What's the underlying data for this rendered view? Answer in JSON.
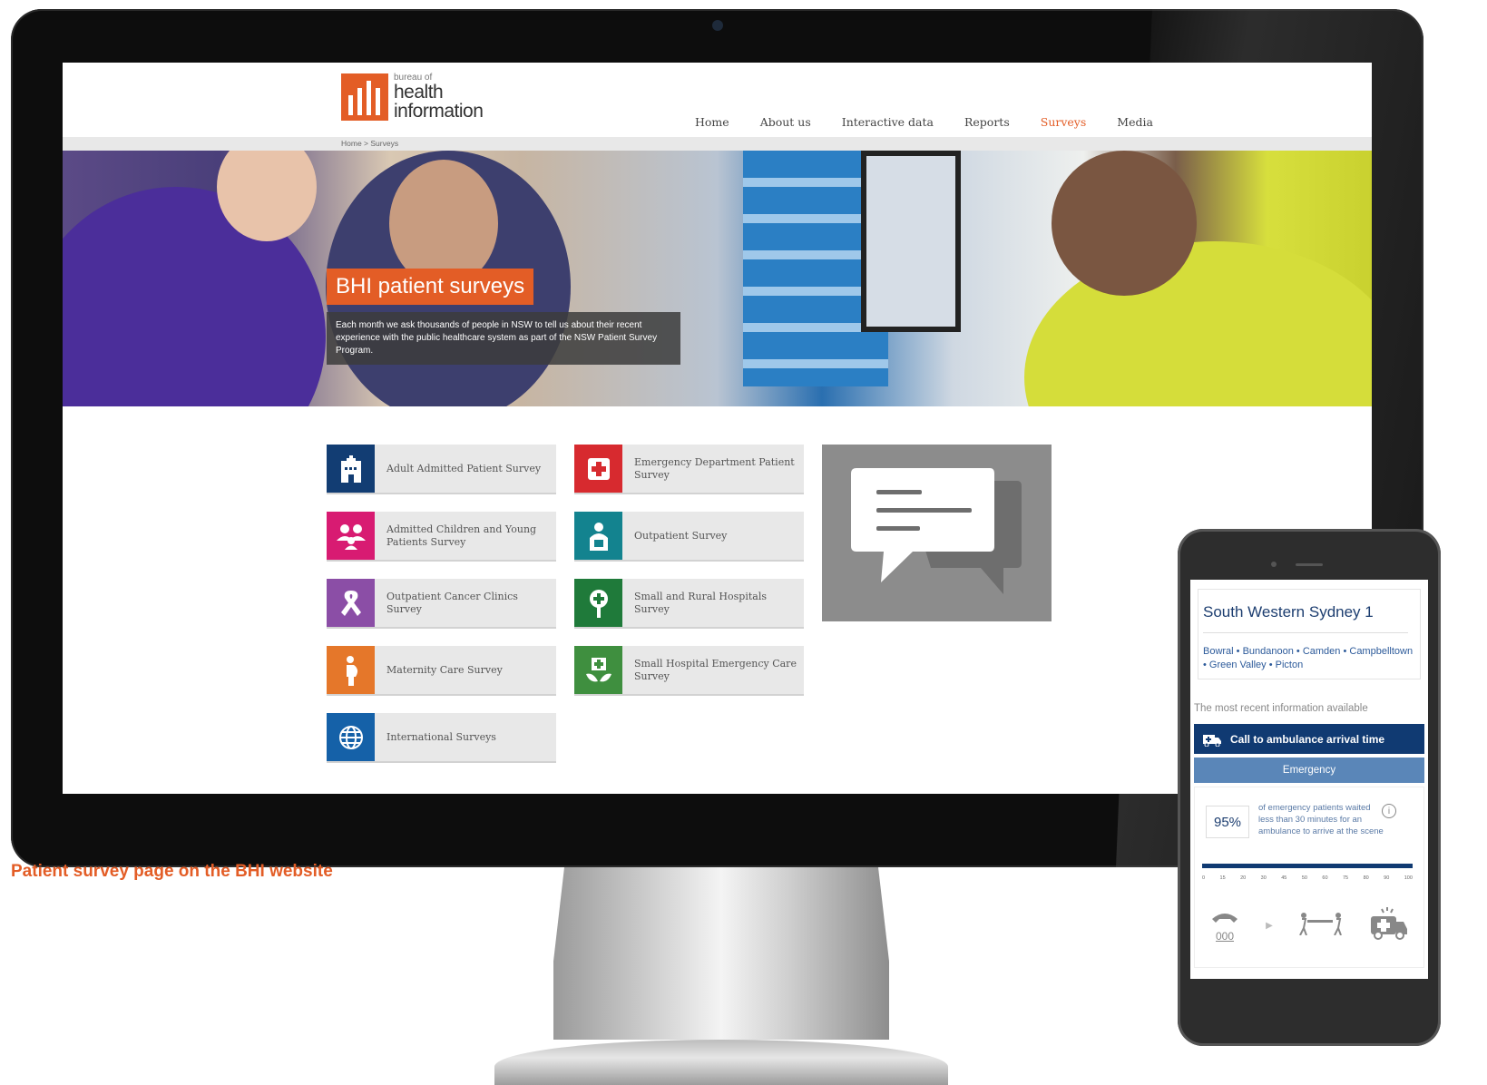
{
  "site": {
    "logo": {
      "line1": "bureau of",
      "line2": "health",
      "line3": "information"
    },
    "nav": [
      {
        "label": "Home"
      },
      {
        "label": "About us"
      },
      {
        "label": "Interactive data"
      },
      {
        "label": "Reports"
      },
      {
        "label": "Surveys",
        "active": true
      },
      {
        "label": "Media"
      }
    ],
    "breadcrumb": "Home > Surveys",
    "hero": {
      "title": "BHI patient surveys",
      "description": "Each month we ask thousands of people in NSW to tell us about their recent experience with the public healthcare system as part of the NSW Patient Survey Program."
    },
    "surveys": [
      {
        "label": "Adult Admitted Patient Survey",
        "color": "#123d73",
        "icon": "hospital-icon"
      },
      {
        "label": "Emergency Department Patient Survey",
        "color": "#d72a2f",
        "icon": "medical-cross-icon"
      },
      {
        "label": "Admitted Children and Young Patients Survey",
        "color": "#d81b72",
        "icon": "family-icon"
      },
      {
        "label": "Outpatient Survey",
        "color": "#13838f",
        "icon": "patient-icon"
      },
      {
        "label": "Outpatient Cancer Clinics Survey",
        "color": "#8b4ea6",
        "icon": "ribbon-icon"
      },
      {
        "label": "Small and Rural Hospitals Survey",
        "color": "#1f7a3a",
        "icon": "tree-icon"
      },
      {
        "label": "Maternity Care Survey",
        "color": "#e5772a",
        "icon": "pregnant-icon"
      },
      {
        "label": "Small Hospital Emergency Care Survey",
        "color": "#3f8f3f",
        "icon": "leaf-cross-icon"
      },
      {
        "label": "International Surveys",
        "color": "#1561a8",
        "icon": "globe-icon"
      }
    ]
  },
  "caption": "Patient survey page on the BHI website",
  "phone": {
    "title": "South Western Sydney 1",
    "places": "Bowral • Bundanoon • Camden • Campbelltown • Green Valley • Picton",
    "recent": "The most recent information available",
    "metric": "Call to ambulance arrival time",
    "category": "Emergency",
    "percent": "95%",
    "description": "of emergency patients waited less than 30 minutes for an ambulance to arrive at the scene",
    "info": "i",
    "ticks": [
      "0",
      "15",
      "20",
      "30",
      "45",
      "50",
      "60",
      "75",
      "80",
      "90",
      "100"
    ],
    "phone_label": "000"
  }
}
